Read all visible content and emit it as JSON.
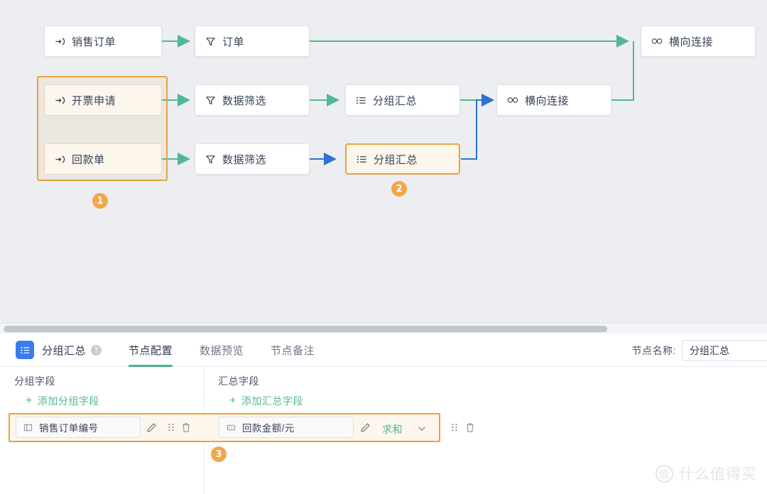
{
  "canvas": {
    "nodes": [
      {
        "id": "n1",
        "label": "销售订单",
        "icon": "data-input-icon"
      },
      {
        "id": "n2",
        "label": "订单",
        "icon": "filter-icon"
      },
      {
        "id": "n3",
        "label": "横向连接",
        "icon": "horizontal-join-icon"
      },
      {
        "id": "n4",
        "label": "开票申请",
        "icon": "data-input-icon"
      },
      {
        "id": "n5",
        "label": "数据筛选",
        "icon": "filter-icon"
      },
      {
        "id": "n6",
        "label": "分组汇总",
        "icon": "group-summary-icon"
      },
      {
        "id": "n7",
        "label": "横向连接",
        "icon": "horizontal-join-icon"
      },
      {
        "id": "n8",
        "label": "回款单",
        "icon": "data-input-icon"
      },
      {
        "id": "n9",
        "label": "数据筛选",
        "icon": "filter-icon"
      },
      {
        "id": "n10",
        "label": "分组汇总",
        "icon": "group-summary-icon"
      }
    ],
    "badges": [
      {
        "id": "b1",
        "text": "1"
      },
      {
        "id": "b2",
        "text": "2"
      },
      {
        "id": "b3",
        "text": "3"
      }
    ],
    "colors": {
      "edge_green": "#52b795",
      "edge_blue": "#2d73d2",
      "highlight_orange": "#e8a33d",
      "badge_orange": "#f0a84a"
    }
  },
  "panel": {
    "header": {
      "icon": "group-summary-icon",
      "title": "分组汇总",
      "help": "?",
      "tabs": [
        {
          "label": "节点配置",
          "active": true
        },
        {
          "label": "数据预览",
          "active": false
        },
        {
          "label": "节点备注",
          "active": false
        }
      ],
      "node_name_label": "节点名称:",
      "node_name_value": "分组汇总"
    },
    "group_field_section": {
      "title": "分组字段",
      "add_label": "添加分组字段",
      "add_plus": "+",
      "field": {
        "name": "销售订单编号",
        "type_icon": "text-field-icon",
        "edit_icon": "pencil-icon",
        "drag_icon": "drag-handle-icon",
        "delete_icon": "trash-icon"
      }
    },
    "summary_field_section": {
      "title": "汇总字段",
      "add_label": "添加汇总字段",
      "add_plus": "+",
      "field": {
        "name": "回款金额/元",
        "type_icon": "number-field-icon",
        "edit_icon": "pencil-icon",
        "aggregation": "求和",
        "dropdown_icon": "chevron-down-icon",
        "drag_icon": "drag-handle-icon",
        "delete_icon": "trash-icon"
      }
    }
  },
  "watermark": {
    "mark": "值",
    "text": "什么值得买"
  }
}
